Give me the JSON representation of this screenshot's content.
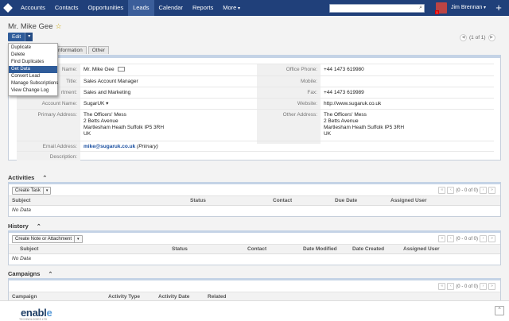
{
  "nav": {
    "items": [
      "Accounts",
      "Contacts",
      "Opportunities",
      "Leads",
      "Calendar",
      "Reports",
      "More"
    ],
    "active_index": 3,
    "user": "Jim Brennan",
    "notifications": "1"
  },
  "record": {
    "title": "Mr. Mike Gee",
    "edit_label": "Edit",
    "pager": "(1 of 1)"
  },
  "actions_menu": [
    "Duplicate",
    "Delete",
    "Find Duplicates",
    "Get Data",
    "Convert Lead",
    "Manage Subscriptions",
    "View Change Log"
  ],
  "actions_selected": 3,
  "tabs": [
    "nformation",
    "Other"
  ],
  "fields": {
    "name_label": "Name:",
    "name": "Mr. Mike Gee",
    "title_label": "Title:",
    "title": "Sales Account Manager",
    "dept_label": "rtment:",
    "dept": "Sales and Marketing",
    "account_label": "Account Name:",
    "account": "SugarUK",
    "primary_label": "Primary Address:",
    "primary": [
      "The Officers' Mess",
      "2 Betts Avenue",
      "Martlesham Heath Suffolk  IP5 3RH",
      "UK"
    ],
    "email_label": "Email Address:",
    "email": "mike@sugaruk.co.uk",
    "email_note": "(Primary)",
    "desc_label": "Description:",
    "office_label": "Office Phone:",
    "office": "+44 1473 619980",
    "mobile_label": "Mobile:",
    "fax_label": "Fax:",
    "fax": "+44 1473 619989",
    "website_label": "Website:",
    "website": "http://www.sugaruk.co.uk",
    "other_label": "Other Address:",
    "other": [
      "The Officers' Mess",
      "2 Betts Avenue",
      "Martlesham Heath Suffolk  IP5 3RH",
      "UK"
    ]
  },
  "activities": {
    "title": "Activities",
    "button": "Create Task",
    "pager": "(0 - 0 of 0)",
    "cols": [
      "Subject",
      "Status",
      "Contact",
      "Due Date",
      "Assigned User"
    ],
    "empty": "No Data"
  },
  "history": {
    "title": "History",
    "button": "Create Note or Attachment",
    "pager": "(0 - 0 of 0)",
    "cols": [
      "Subject",
      "Status",
      "Contact",
      "Date Modified",
      "Date Created",
      "Assigned User"
    ],
    "empty": "No Data"
  },
  "campaigns": {
    "title": "Campaigns",
    "pager": "(0 - 0 of 0)",
    "cols": [
      "Campaign",
      "Activity Type",
      "Activity Date",
      "Related"
    ]
  },
  "footer": {
    "brand_a": "enabl",
    "brand_b": "e",
    "tagline": "TECHNOLOGIES LTD"
  }
}
